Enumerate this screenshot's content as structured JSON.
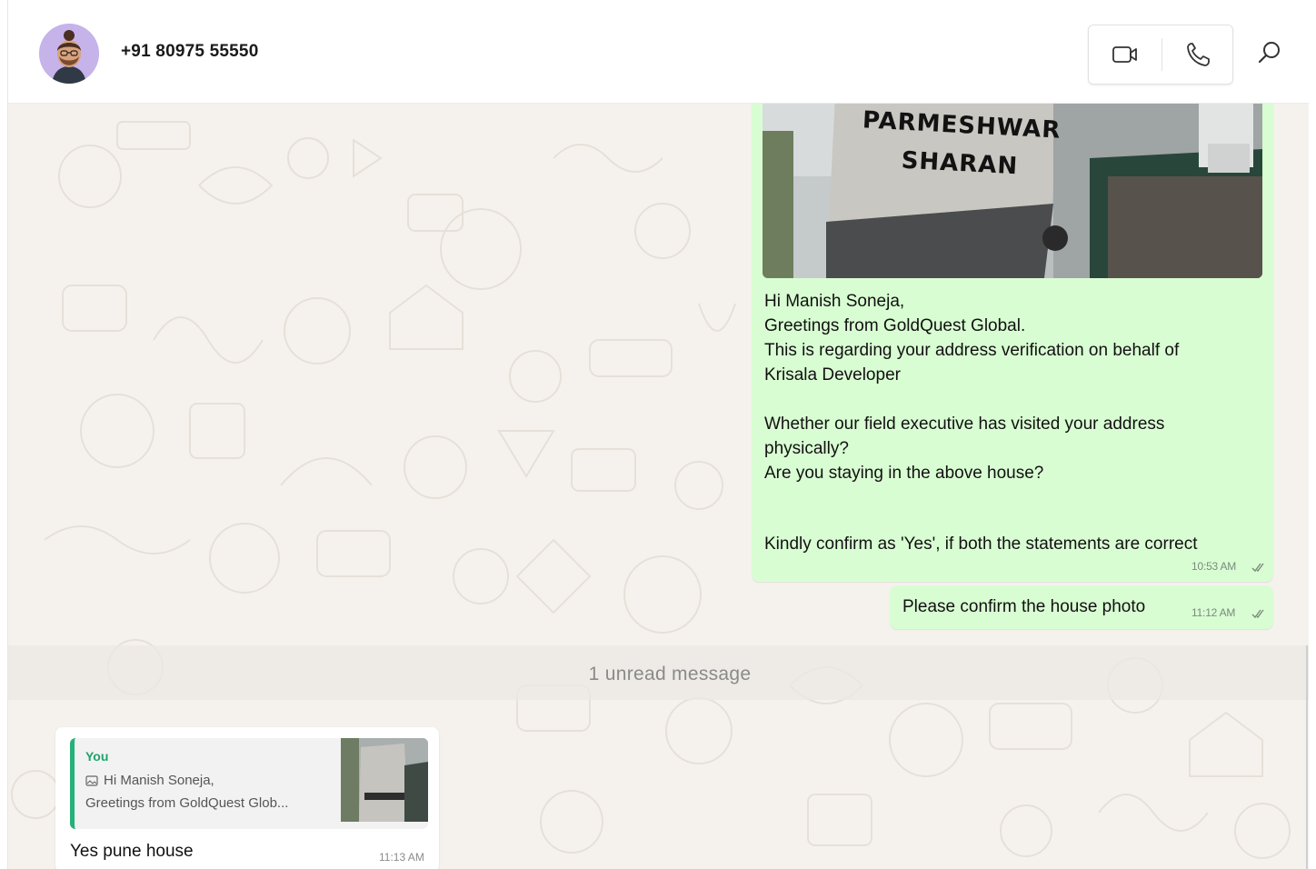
{
  "header": {
    "contact_name": "+91 80975 55550",
    "avatar_icon": "memoji-avatar",
    "video_call_icon": "video-camera-icon",
    "voice_call_icon": "phone-icon",
    "search_icon": "search-icon"
  },
  "messages": {
    "image_message": {
      "photo_sign_line1": "PARMESHWAR",
      "photo_sign_line2": "SHARAN",
      "lines": [
        "Hi Manish Soneja,",
        "Greetings from GoldQuest Global.",
        "This is regarding your address verification on behalf of",
        "Krisala Developer",
        "",
        "Whether our field executive has visited your address",
        "physically?",
        "Are you staying in the above house?"
      ],
      "last_line": "Kindly confirm as 'Yes', if both the statements are correct",
      "time": "10:53 AM",
      "status": "read"
    },
    "confirm_message": {
      "text": "Please confirm the house photo",
      "time": "11:12 AM",
      "status": "read"
    },
    "unread_separator": "1 unread message",
    "reply_message": {
      "quote_author": "You",
      "quote_line1": "Hi Manish Soneja,",
      "quote_line2": "Greetings from GoldQuest Glob...",
      "quote_icon": "photo-icon",
      "text": "Yes pune house",
      "time": "11:13 AM"
    }
  },
  "colors": {
    "outgoing_bubble": "#d9fdd3",
    "incoming_bubble": "#ffffff",
    "quote_accent": "#25b17a",
    "wallpaper": "#f5f2ee"
  }
}
